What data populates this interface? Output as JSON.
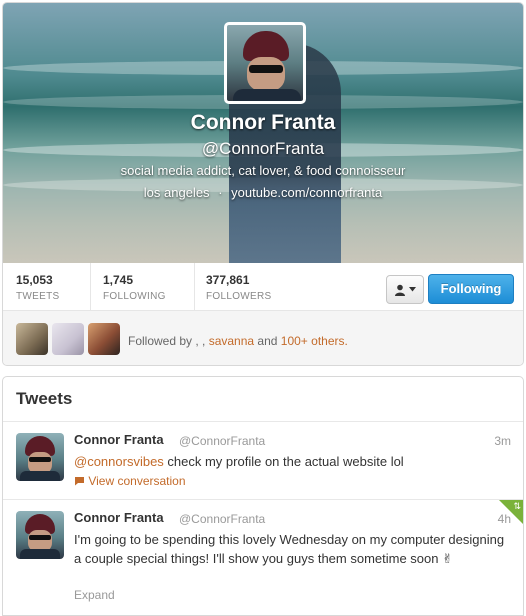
{
  "profile": {
    "name": "Connor Franta",
    "handle": "@ConnorFranta",
    "bio": "social media addict, cat lover, & food connoisseur",
    "location": "los angeles",
    "separator": "·",
    "website": "youtube.com/connorfranta"
  },
  "stats": [
    {
      "value": "15,053",
      "label": "TWEETS"
    },
    {
      "value": "1,745",
      "label": "FOLLOWING"
    },
    {
      "value": "377,861",
      "label": "FOLLOWERS"
    }
  ],
  "actions": {
    "following_label": "Following",
    "user_menu_icon": "person-icon",
    "chevron_icon": "chevron-down-icon"
  },
  "followed_by": {
    "prefix": "Followed by , , ",
    "user": "savanna",
    "and": " and ",
    "others": "100+ others."
  },
  "tweets_title": "Tweets",
  "tweets": [
    {
      "name": "Connor Franta",
      "handle": "@ConnorFranta",
      "time": "3m",
      "mention": "@connorsvibes",
      "text": " check my profile on the actual website lol",
      "action": "View conversation",
      "action_icon": "speech-bubble-icon"
    },
    {
      "name": "Connor Franta",
      "handle": "@ConnorFranta",
      "time": "4h",
      "mention": "",
      "text": "I'm going to be spending this lovely Wednesday on my computer designing a couple special things! I'll show you guys them sometime soon ✌",
      "action": "Expand"
    }
  ],
  "colors": {
    "link_orange": "#c36b2b",
    "button_blue": "#1d8dd6",
    "retweet_green": "#7ab23a"
  }
}
